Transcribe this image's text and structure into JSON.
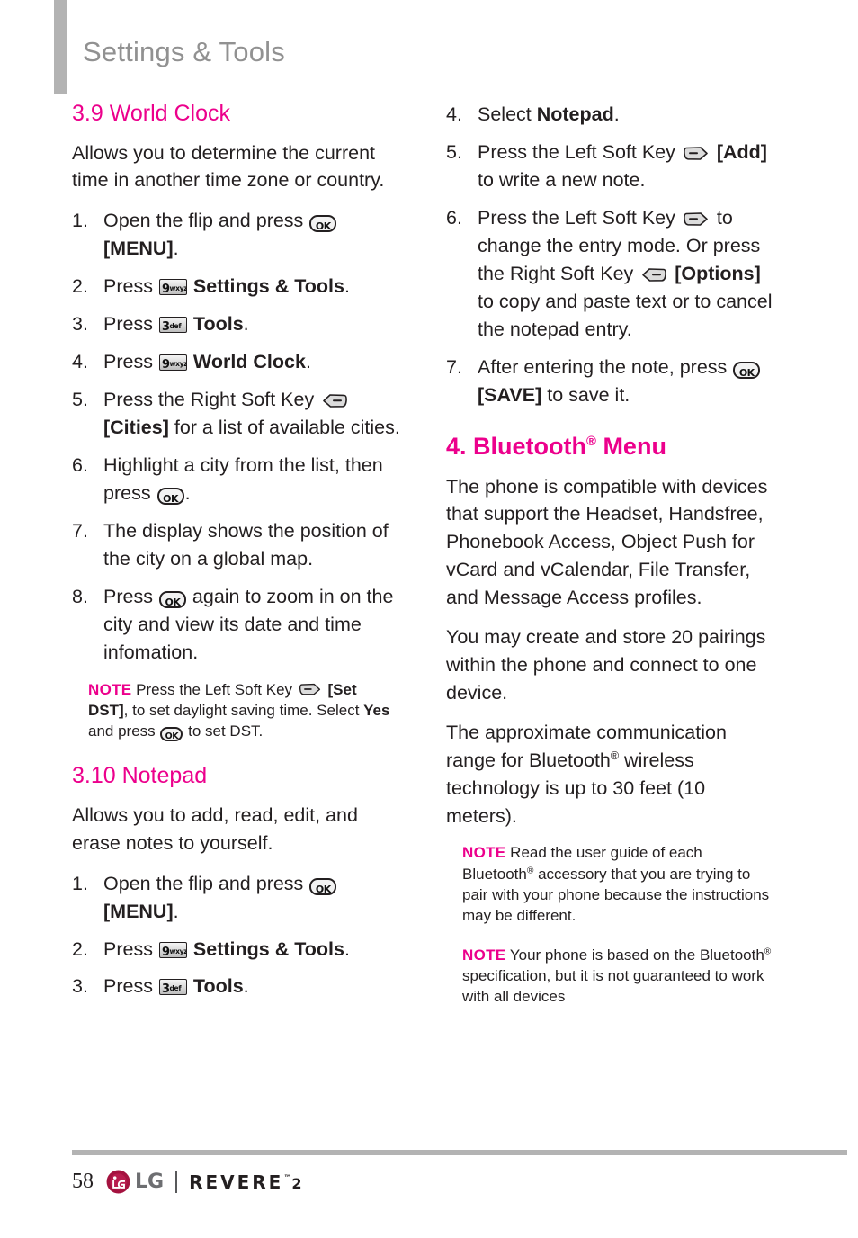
{
  "header": {
    "title": "Settings & Tools"
  },
  "colors": {
    "accent_magenta": "#ec008c",
    "header_gray": "#919191",
    "rule_gray": "#b3b3b3",
    "body_text": "#231f20",
    "lg_logo": "#a4123f"
  },
  "left_column": {
    "section_world_clock": {
      "heading": "3.9 World Clock",
      "intro": "Allows you to determine the current time in another time zone or country.",
      "steps": [
        {
          "num": "1.",
          "pre": "Open the flip and press ",
          "icon": "ok-key-icon",
          "post": " ",
          "bold": "[MENU]",
          "tail": "."
        },
        {
          "num": "2.",
          "pre": "Press ",
          "icon": "key-9-wxyz-icon",
          "post": " ",
          "bold": "Settings & Tools",
          "tail": "."
        },
        {
          "num": "3.",
          "pre": "Press ",
          "icon": "key-3-def-icon",
          "post": " ",
          "bold": "Tools",
          "tail": "."
        },
        {
          "num": "4.",
          "pre": "Press ",
          "icon": "key-9-wxyz-icon",
          "post": " ",
          "bold": "World Clock",
          "tail": "."
        },
        {
          "num": "5.",
          "pre": "Press the Right Soft Key ",
          "icon": "right-soft-key-icon",
          "post": " ",
          "bold": "[Cities]",
          "tail": " for a list of available cities."
        },
        {
          "num": "6.",
          "pre": "Highlight a city from the list, then press ",
          "icon": "ok-key-icon",
          "post": "",
          "bold": "",
          "tail": "."
        },
        {
          "num": "7.",
          "pre": "The display shows the position of the city on a global map.",
          "icon": "",
          "post": "",
          "bold": "",
          "tail": ""
        },
        {
          "num": "8.",
          "pre": "Press ",
          "icon": "ok-key-icon",
          "post": "",
          "bold": "",
          "tail": " again to zoom in on the city and view its date and time infomation."
        }
      ],
      "note": {
        "label": "NOTE",
        "part1": " Press the Left Soft Key ",
        "icon": "left-soft-key-icon",
        "bold1": " [Set DST]",
        "part2": ", to set daylight saving time. Select ",
        "bold2": "Yes",
        "part3": " and press ",
        "icon2": "ok-key-icon",
        "part4": " to set DST."
      }
    },
    "section_notepad": {
      "heading": "3.10 Notepad",
      "intro": "Allows you to add, read, edit, and erase notes to yourself.",
      "steps": [
        {
          "num": "1.",
          "pre": "Open the flip and press ",
          "icon": "ok-key-icon",
          "post": " ",
          "bold": "[MENU]",
          "tail": "."
        },
        {
          "num": "2.",
          "pre": "Press ",
          "icon": "key-9-wxyz-icon",
          "post": " ",
          "bold": "Settings & Tools",
          "tail": "."
        },
        {
          "num": "3.",
          "pre": "Press ",
          "icon": "key-3-def-icon",
          "post": " ",
          "bold": "Tools",
          "tail": "."
        }
      ]
    }
  },
  "right_column": {
    "notepad_steps_continued": [
      {
        "num": "4.",
        "pre": "Select ",
        "icon": "",
        "post": "",
        "bold": "Notepad",
        "tail": "."
      },
      {
        "num": "5.",
        "pre": "Press the Left Soft Key ",
        "icon": "left-soft-key-icon",
        "post": " ",
        "bold": "[Add]",
        "tail": " to write a new note."
      },
      {
        "num": "6.",
        "pre": "Press the Left Soft Key ",
        "icon": "left-soft-key-icon",
        "post": " to change the entry mode. Or press the Right Soft Key ",
        "icon2": "right-soft-key-icon",
        "post2": " ",
        "bold": "[Options]",
        "tail": " to copy and paste text or to cancel the notepad entry."
      },
      {
        "num": "7.",
        "pre": "After entering the note, press ",
        "icon": "ok-key-icon",
        "post": " ",
        "bold": "[SAVE]",
        "tail": " to save it."
      }
    ],
    "section_bluetooth": {
      "heading_pre": "4. Bluetooth",
      "heading_reg": "®",
      "heading_post": " Menu",
      "paragraphs": [
        {
          "pre": "The phone is compatible with devices that support the Headset, Handsfree, Phonebook Access, Object Push for vCard and vCalendar, File Transfer, and Message Access profiles.",
          "reg": "",
          "post": ""
        },
        {
          "pre": "You may create and store 20 pairings within the phone and connect to one device.",
          "reg": "",
          "post": ""
        },
        {
          "pre": "The approximate communication range for Bluetooth",
          "reg": "®",
          "post": " wireless technology is up to 30 feet (10 meters)."
        }
      ],
      "notes": [
        {
          "label": "NOTE",
          "part1": " Read the user guide of each Bluetooth",
          "reg": "®",
          "part2": " accessory that you are trying to pair with your phone because the instructions may be different."
        },
        {
          "label": "NOTE",
          "part1": " Your phone is based on the Bluetooth",
          "reg": "®",
          "part2": " specification, but it is not guaranteed to work with all devices"
        }
      ]
    }
  },
  "footer": {
    "page_number": "58",
    "brand": "LG",
    "model_pre": "REVERE",
    "model_tm": "™",
    "model_num": "2"
  },
  "key_icons": {
    "key-9-wxyz-icon": {
      "digit": "9",
      "letters": "wxyz"
    },
    "key-3-def-icon": {
      "digit": "3",
      "letters": "def"
    },
    "ok-key-icon": {
      "label": "OK"
    },
    "left-soft-key-icon": {
      "label": "Left Soft Key"
    },
    "right-soft-key-icon": {
      "label": "Right Soft Key"
    }
  }
}
